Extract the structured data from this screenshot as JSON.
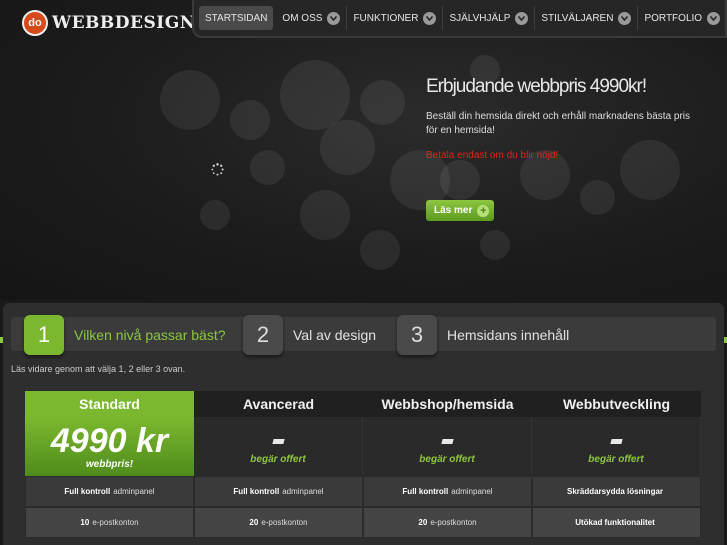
{
  "logo": {
    "badge": "do",
    "text": "WEBBDESIGN"
  },
  "nav": [
    {
      "label": "STARTSIDAN",
      "active": true,
      "dropdown": false
    },
    {
      "label": "OM OSS",
      "active": false,
      "dropdown": true
    },
    {
      "label": "FUNKTIONER",
      "active": false,
      "dropdown": true
    },
    {
      "label": "SJÄLVHJÄLP",
      "active": false,
      "dropdown": true
    },
    {
      "label": "STILVÄLJAREN",
      "active": false,
      "dropdown": true
    },
    {
      "label": "PORTFOLIO",
      "active": false,
      "dropdown": true
    }
  ],
  "hero": {
    "title": "Erbjudande webbpris 4990kr!",
    "description": "Beställ din hemsida direkt och erhåll marknadens bästa pris för en hemsida!",
    "highlight": "Betala endast om du blir nöjd!",
    "button_label": "Läs mer",
    "button_icon": "plus-icon"
  },
  "steps": [
    {
      "number": "1",
      "label": "Vilken nivå passar bäst?",
      "active": true
    },
    {
      "number": "2",
      "label": "Val av design",
      "active": false
    },
    {
      "number": "3",
      "label": "Hemsidans innehåll",
      "active": false
    }
  ],
  "hint": "Läs vidare genom att välja 1, 2 eller 3 ovan.",
  "pricing": {
    "plans": [
      {
        "name": "Standard",
        "price": "4990 kr",
        "price_sub": "webbpris!"
      },
      {
        "name": "Avancerad",
        "price": "-",
        "offer": "begär offert"
      },
      {
        "name": "Webbshop/hemsida",
        "price": "-",
        "offer": "begär offert"
      },
      {
        "name": "Webbutveckling",
        "price": "-",
        "offer": "begär offert"
      }
    ],
    "features": [
      [
        {
          "bold": "Full kontroll",
          "rest": "adminpanel"
        },
        {
          "bold": "Full kontroll",
          "rest": "adminpanel"
        },
        {
          "bold": "Full kontroll",
          "rest": "adminpanel"
        },
        {
          "bold": "Skräddarsydda lösningar",
          "rest": ""
        }
      ],
      [
        {
          "bold": "10",
          "rest": "e-postkonton"
        },
        {
          "bold": "20",
          "rest": "e-postkonton"
        },
        {
          "bold": "20",
          "rest": "e-postkonton"
        },
        {
          "bold": "Utökad funktionalitet",
          "rest": ""
        }
      ]
    ]
  },
  "colors": {
    "accent_green": "#7cb82f",
    "highlight_red": "#e0251b",
    "logo_orange": "#d64a1a"
  }
}
